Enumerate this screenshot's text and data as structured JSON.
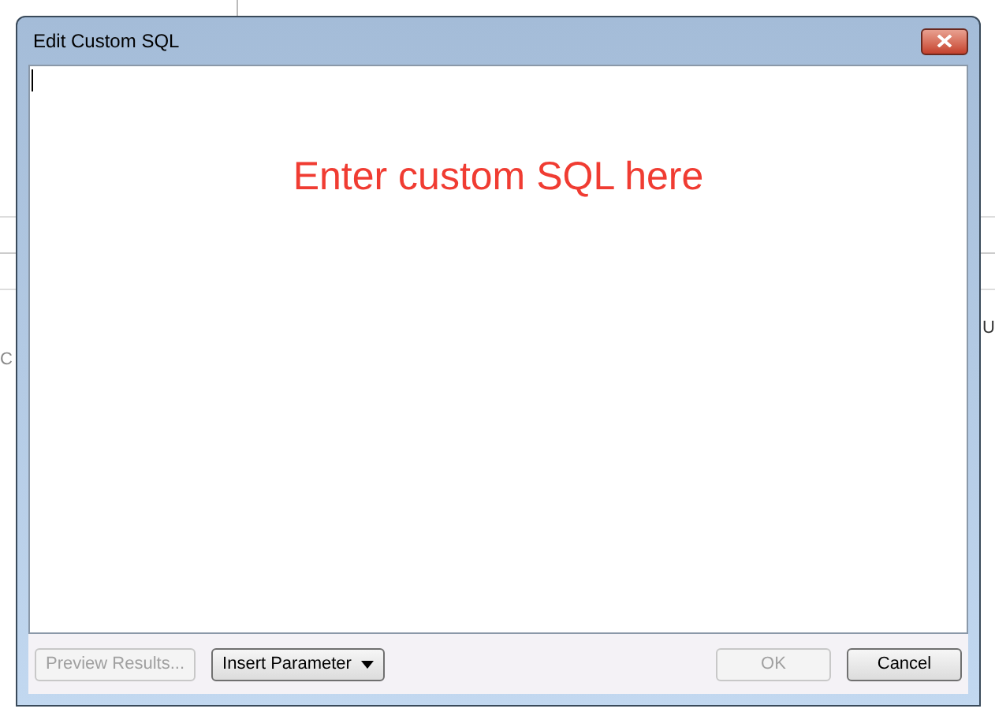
{
  "background": {
    "fragments": [
      {
        "text": "C",
        "kind": "grey"
      },
      {
        "text": "U",
        "kind": "dark"
      }
    ]
  },
  "dialog": {
    "title": "Edit Custom SQL",
    "annotation": "Enter custom SQL here",
    "buttons": [
      {
        "label": "Preview Results...",
        "disabled": true,
        "kind": "plain"
      },
      {
        "label": "Insert Parameter",
        "disabled": false,
        "kind": "dropdown"
      },
      {
        "label": "OK",
        "disabled": true,
        "kind": "plain"
      },
      {
        "label": "Cancel",
        "disabled": false,
        "kind": "plain"
      }
    ]
  }
}
